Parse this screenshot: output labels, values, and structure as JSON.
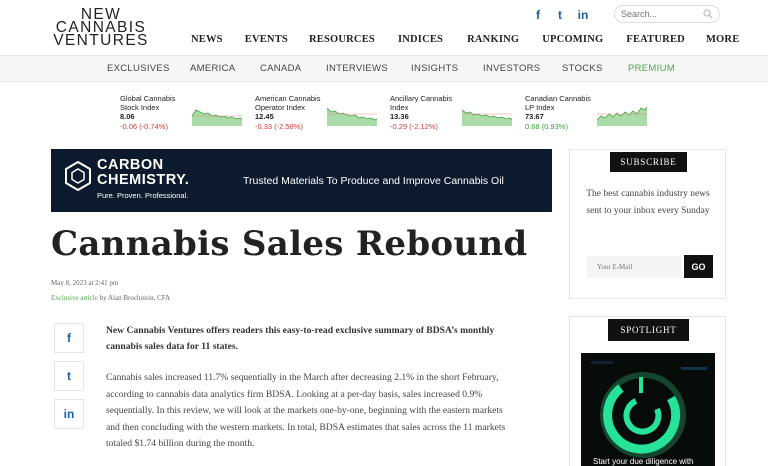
{
  "logo": {
    "line1": "NEW",
    "line2": "CANNABIS",
    "line3": "VENTURES"
  },
  "social": {
    "facebook": "f",
    "twitter": "t",
    "linkedin": "in"
  },
  "search": {
    "placeholder": "Search..."
  },
  "main_nav": [
    "NEWS",
    "EVENTS",
    "RESOURCES",
    "INDICES",
    "RANKING",
    "UPCOMING",
    "FEATURED",
    "MORE"
  ],
  "sub_nav": [
    "EXCLUSIVES",
    "AMERICA",
    "CANADA",
    "INTERVIEWS",
    "INSIGHTS",
    "INVESTORS",
    "STOCKS",
    "PREMIUM"
  ],
  "indices": [
    {
      "name": "Global Cannabis Stock Index",
      "value": "8.06",
      "change": "-0.06 (-0.74%)"
    },
    {
      "name": "American Cannabis Operator Index",
      "value": "12.45",
      "change": "-0.33 (-2.58%)"
    },
    {
      "name": "Ancillary Cannabis Index",
      "value": "13.36",
      "change": "-0.29 (-2.12%)"
    },
    {
      "name": "Canadian Cannabis LP Index",
      "value": "73.67",
      "change": "0.68 (0.93%)"
    }
  ],
  "colors": {
    "accent_green": "#4aa84a",
    "negative": "#d23b3b",
    "social_blue": "#1a5fa8",
    "banner_bg": "#0c1a2e"
  },
  "banner": {
    "line1": "CARBON",
    "line2": "CHEMISTRY.",
    "line3": "Pure. Proven. Professional.",
    "tagline": "Trusted Materials To Produce and Improve Cannabis Oil"
  },
  "article": {
    "title": "Cannabis Sales Rebound",
    "date": "May 8, 2023 at 2:41 pm",
    "exclusive": "Exclusive article",
    "by": " by Alan Brochstein, CFA",
    "lead": "New Cannabis Ventures offers readers this easy-to-read exclusive summary of BDSA’s monthly cannabis sales data for 11 states.",
    "para1": "Cannabis sales increased 11.7% sequentially in  the March after decreasing 2.1% in the short February, according to cannabis data analytics firm BDSA. Looking at a per-day basis, sales increased 0.9% sequentially. In this review, we will look at the markets one-by-one, beginning with the eastern markets and then concluding with the western markets. In total, BDSA estimates that sales across the 11 markets totaled $1.74 billion during the month."
  },
  "share": {
    "facebook": "f",
    "twitter": "t",
    "linkedin": "in"
  },
  "subscribe": {
    "button": "SUBSCRIBE",
    "text": "The best cannabis industry news sent to your inbox every Sunday",
    "email_placeholder": "Your E-Mail",
    "go": "GO"
  },
  "spotlight": {
    "button": "SPOTLIGHT",
    "caption": "Start your due diligence with"
  }
}
